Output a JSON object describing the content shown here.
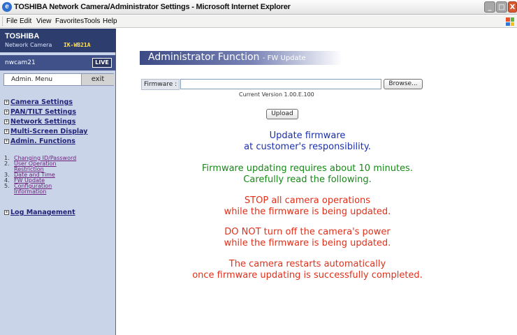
{
  "window": {
    "title": "TOSHIBA Network Camera/Administrator Settings - Microsoft Internet Explorer",
    "icon": "e",
    "buttons": {
      "minimize": "_",
      "maximize": "□",
      "close": "X"
    }
  },
  "menu": [
    "File",
    "Edit",
    "View",
    "Favorites",
    "Tools",
    "Help"
  ],
  "sidebar": {
    "brand": "TOSHIBA",
    "product": "Network Camera",
    "model": "IK-WB21A",
    "camera_name": "nwcam21",
    "live_label": "LIVE",
    "admin_menu_label": "Admin. Menu",
    "exit_label": "exit",
    "nav": [
      {
        "label": "Camera Settings"
      },
      {
        "label": "PAN/TILT Settings"
      },
      {
        "label": "Network Settings"
      },
      {
        "label": "Multi-Screen Display"
      },
      {
        "label": "Admin. Functions"
      }
    ],
    "sub_items": [
      {
        "num": "1.",
        "lines": [
          "Changing ID/Password"
        ]
      },
      {
        "num": "2.",
        "lines": [
          "User Operation",
          "Restriction"
        ]
      },
      {
        "num": "3.",
        "lines": [
          "Date and Time"
        ]
      },
      {
        "num": "4.",
        "lines": [
          "FW Update"
        ]
      },
      {
        "num": "5.",
        "lines": [
          "Configuration",
          "Information"
        ]
      }
    ],
    "log_management": "Log Management"
  },
  "main": {
    "header_title": "Administrator Function",
    "header_sub": "- FW Update",
    "firmware_label": "Firmware :",
    "firmware_value": "",
    "browse_label": "Browse...",
    "version_text": "Current  Version 1.00.E.100",
    "upload_label": "Upload",
    "messages": {
      "blue": [
        "Update firmware",
        "at customer's responsibility."
      ],
      "green": [
        "Firmware updating requires about 10 minutes.",
        "Carefully read the following."
      ],
      "red1": [
        "STOP all camera operations",
        "while the firmware is being updated."
      ],
      "red2": [
        "DO NOT turn off the camera's power",
        "while the firmware is being updated."
      ],
      "red3": [
        "The camera restarts automatically",
        "once firmware updating is successfully completed."
      ]
    }
  },
  "colors": {
    "sidebar_bg": "#c9d4e8",
    "brand_bg": "#2d3e6e",
    "blue_text": "#1a2fae",
    "green_text": "#168a16",
    "red_text": "#e0301a"
  }
}
